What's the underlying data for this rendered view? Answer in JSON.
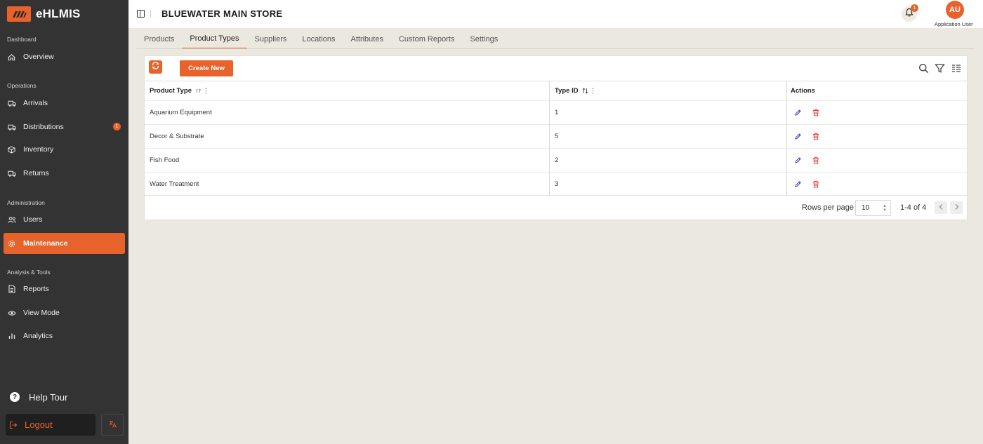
{
  "brand": {
    "name": "eHLMIS"
  },
  "sidebar": {
    "sections": [
      {
        "label": "Dashboard"
      },
      {
        "label": "Operations"
      },
      {
        "label": "Administration"
      },
      {
        "label": "Analysis & Tools"
      }
    ],
    "items": [
      {
        "label": "Overview",
        "icon": "home-icon"
      },
      {
        "label": "Arrivals",
        "icon": "truck-arrival-icon"
      },
      {
        "label": "Distributions",
        "icon": "truck-icon",
        "badge": "1"
      },
      {
        "label": "Inventory",
        "icon": "box-icon"
      },
      {
        "label": "Returns",
        "icon": "return-truck-icon"
      },
      {
        "label": "Users",
        "icon": "users-icon"
      },
      {
        "label": "Maintenance",
        "icon": "gear-icon",
        "active": true
      },
      {
        "label": "Reports",
        "icon": "document-icon"
      },
      {
        "label": "View Mode",
        "icon": "eye-icon"
      },
      {
        "label": "Analytics",
        "icon": "bar-chart-icon"
      }
    ],
    "help_tour": "Help Tour",
    "logout": "Logout",
    "accent": "#e8622c",
    "background": "#333333"
  },
  "header": {
    "store_title": "BLUEWATER MAIN STORE",
    "notification_count": "1",
    "avatar_initials": "AU",
    "user_name": "Application User"
  },
  "tabs": [
    {
      "label": "Products"
    },
    {
      "label": "Product Types",
      "active": true
    },
    {
      "label": "Suppliers"
    },
    {
      "label": "Locations"
    },
    {
      "label": "Attributes"
    },
    {
      "label": "Custom Reports"
    },
    {
      "label": "Settings"
    }
  ],
  "toolbar": {
    "create_label": "Create New"
  },
  "table": {
    "columns": [
      "Product Type",
      "Type ID",
      "Actions"
    ],
    "rows": [
      {
        "product_type": "Aquarium Equipment",
        "type_id": "1"
      },
      {
        "product_type": "Decor & Substrate",
        "type_id": "5"
      },
      {
        "product_type": "Fish Food",
        "type_id": "2"
      },
      {
        "product_type": "Water Treatment",
        "type_id": "3"
      }
    ]
  },
  "pagination": {
    "rows_per_page_label": "Rows per page",
    "rows_per_page_value": "10",
    "range": "1-4 of 4"
  }
}
